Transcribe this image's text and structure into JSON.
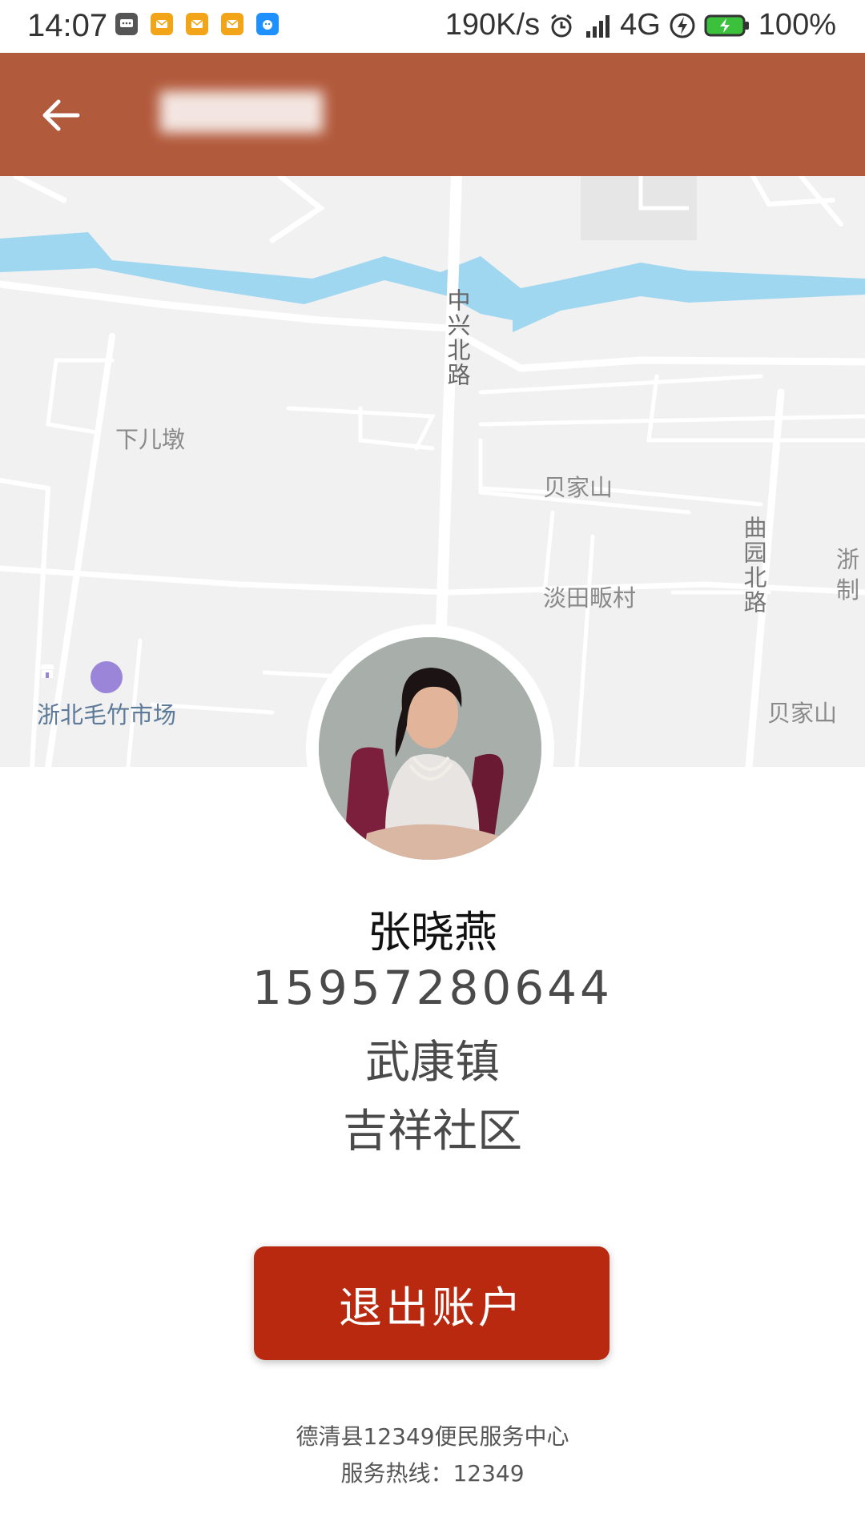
{
  "status_bar": {
    "time": "14:07",
    "speed": "190K/s",
    "network": "4G",
    "battery": "100%",
    "notifications": [
      "message-icon",
      "mail-icon",
      "mail-icon",
      "mail-icon",
      "app-icon"
    ]
  },
  "header": {
    "title": "██████",
    "back_icon": "arrow-left-icon",
    "color": "#b25a3c"
  },
  "map": {
    "labels": {
      "road_zhongxing": "中兴北路",
      "village_xiaerdun": "下儿墩",
      "village_beijiashan": "贝家山",
      "village_tantian": "淡田畈村",
      "road_quyuan": "曲园北路",
      "edge_zhe": "浙",
      "edge_zhi": "制",
      "village_beijiashan_2": "贝家山"
    },
    "poi": {
      "label": "浙北毛竹市场",
      "icon": "shop-icon"
    }
  },
  "profile": {
    "name": "张晓燕",
    "phone": "15957280644",
    "town": "武康镇",
    "community": "吉祥社区"
  },
  "actions": {
    "logout_label": "退出账户",
    "logout_color": "#b9290f"
  },
  "footer": {
    "center": "德清县12349便民服务中心",
    "hotline": "服务热线：12349"
  }
}
